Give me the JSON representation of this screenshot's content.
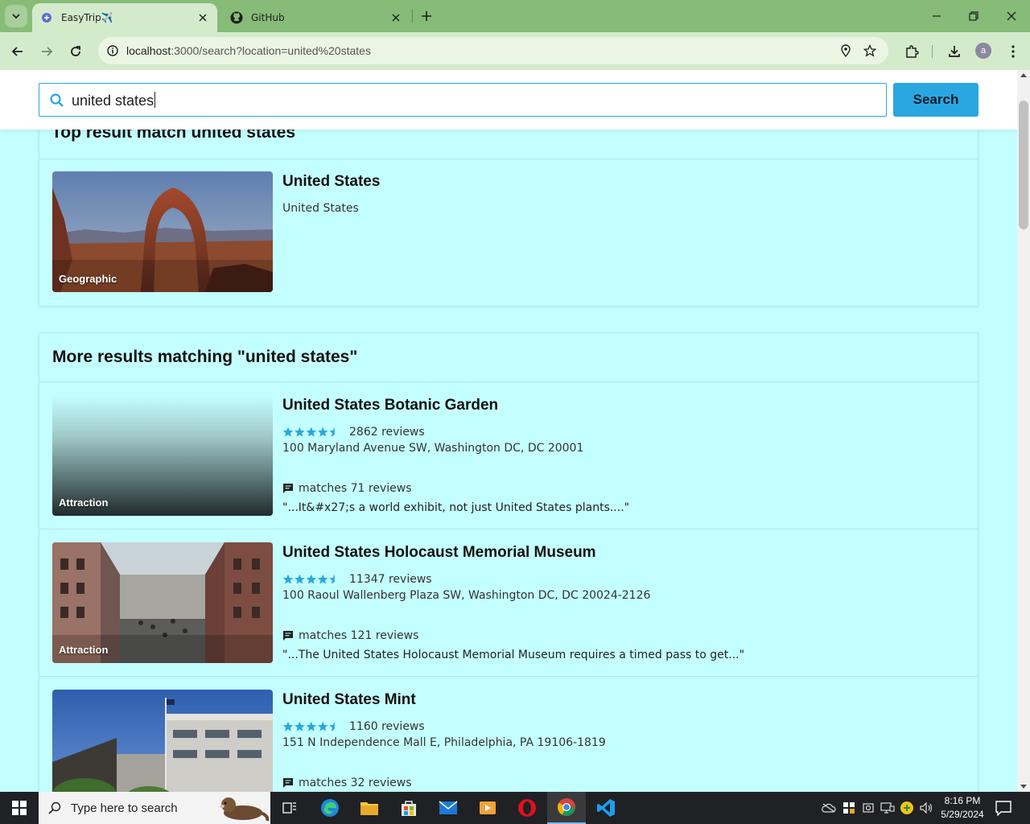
{
  "browser": {
    "tabs": [
      {
        "title": "EasyTrip✈️",
        "active": true
      },
      {
        "title": "GitHub",
        "active": false
      }
    ],
    "url_host": "localhost",
    "url_rest": ":3000/search?location=united%20states",
    "profile_initial": "a"
  },
  "search": {
    "query": "united states",
    "button_label": "Search"
  },
  "top_result": {
    "heading_text": "Top result match  united states",
    "title": "United States",
    "subtitle": "United States",
    "category": "Geographic"
  },
  "more_results": {
    "heading_text": "More results matching \"united states\"",
    "items": [
      {
        "title": "United States Botanic Garden",
        "rating": 4.5,
        "reviews_text": "2862 reviews",
        "address": "100 Maryland Avenue SW, Washington DC, DC 20001",
        "matches_text": "matches 71 reviews",
        "quote": "\"...It&#x27;s a world exhibit, not just United States plants....\"",
        "category": "Attraction"
      },
      {
        "title": "United States Holocaust Memorial Museum",
        "rating": 4.5,
        "reviews_text": "11347 reviews",
        "address": "100 Raoul Wallenberg Plaza SW, Washington DC, DC 20024-2126",
        "matches_text": "matches 121 reviews",
        "quote": "\"...The United States Holocaust Memorial Museum requires a timed pass to get...\"",
        "category": "Attraction"
      },
      {
        "title": "United States Mint",
        "rating": 4.5,
        "reviews_text": "1160 reviews",
        "address": "151 N Independence Mall E, Philadelphia, PA 19106-1819",
        "matches_text": "matches 32 reviews",
        "quote": "",
        "category": ""
      }
    ]
  },
  "taskbar": {
    "search_placeholder": "Type here to search",
    "time": "8:16 PM",
    "date": "5/29/2024"
  },
  "colors": {
    "page_bg": "#c4ffff",
    "accent": "#2aa7e0",
    "chrome_tab_strip": "#86bb78",
    "chrome_toolbar": "#d4ebcb",
    "star": "#2aa7e0"
  }
}
